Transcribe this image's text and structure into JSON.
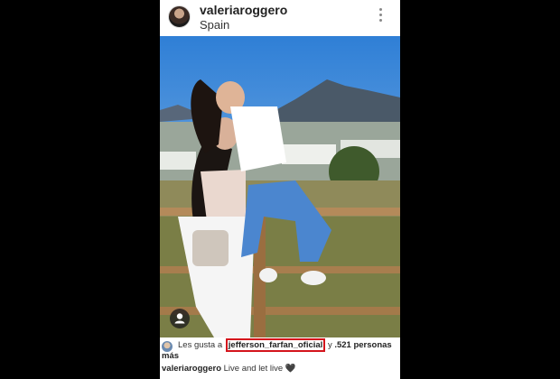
{
  "post": {
    "username": "valeriaroggero",
    "location": "Spain",
    "likes": {
      "prefix": "Les gusta a",
      "highlighted_user": "jefferson_farfan_oficial",
      "connector": "y",
      "count_text": ".521 personas",
      "suffix": "más"
    },
    "caption": {
      "username": "valeriaroggero",
      "text": "Live and let live",
      "emoji": "🖤"
    }
  },
  "colors": {
    "highlight_border": "#d4141c",
    "background": "#000000"
  },
  "icons": [
    "more-options-icon",
    "user-tag-icon",
    "heart-icon"
  ]
}
